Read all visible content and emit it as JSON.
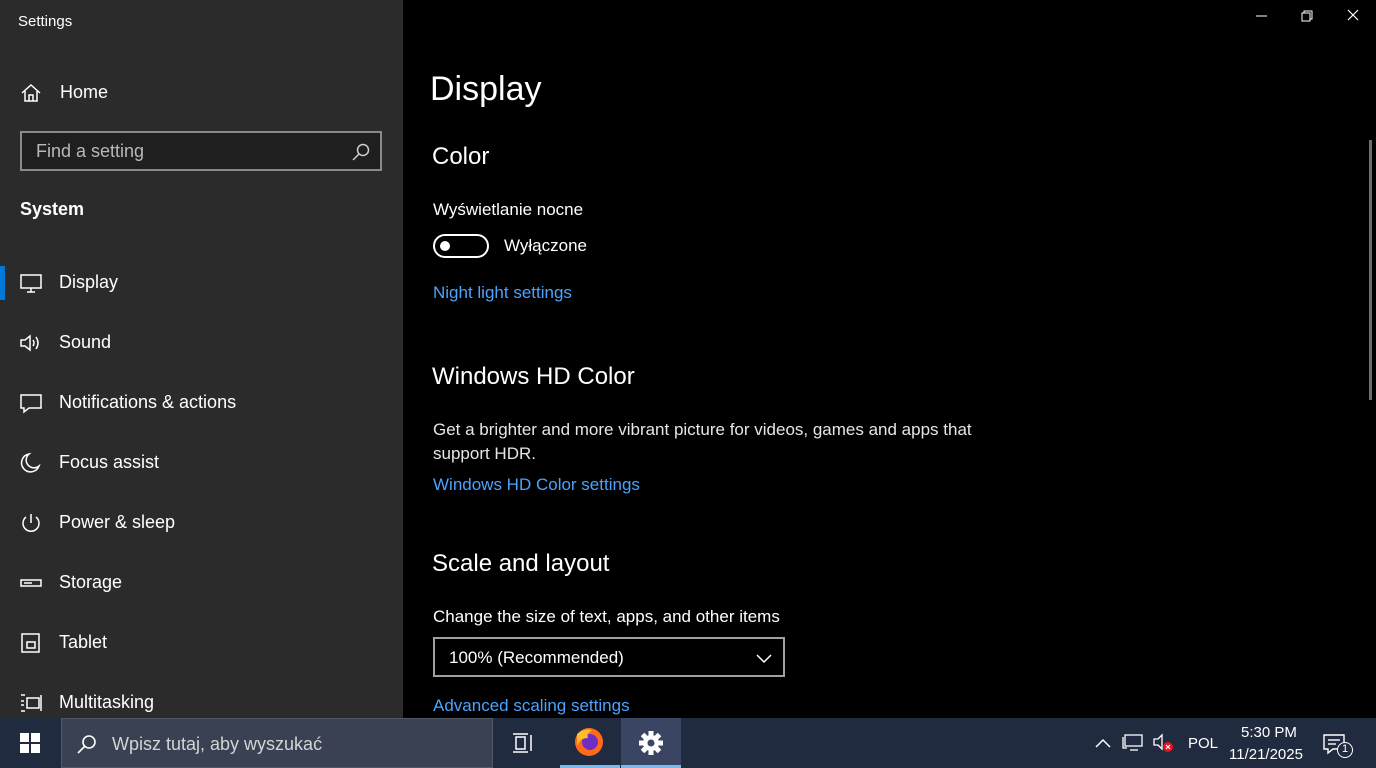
{
  "window": {
    "title": "Settings"
  },
  "sidebar": {
    "home_label": "Home",
    "search_placeholder": "Find a setting",
    "section": "System",
    "items": [
      {
        "label": "Display",
        "icon": "monitor-icon",
        "active": true
      },
      {
        "label": "Sound",
        "icon": "speaker-icon"
      },
      {
        "label": "Notifications & actions",
        "icon": "notification-icon"
      },
      {
        "label": "Focus assist",
        "icon": "moon-icon"
      },
      {
        "label": "Power & sleep",
        "icon": "power-icon"
      },
      {
        "label": "Storage",
        "icon": "storage-icon"
      },
      {
        "label": "Tablet",
        "icon": "tablet-icon"
      },
      {
        "label": "Multitasking",
        "icon": "multitasking-icon"
      }
    ]
  },
  "main": {
    "title": "Display",
    "color": {
      "heading": "Color",
      "night_label": "Wyświetlanie nocne",
      "toggle_state": "Wyłączone",
      "night_link": "Night light settings"
    },
    "hd": {
      "heading": "Windows HD Color",
      "description": "Get a brighter and more vibrant picture for videos, games and apps that support HDR.",
      "link": "Windows HD Color settings"
    },
    "scale": {
      "heading": "Scale and layout",
      "label": "Change the size of text, apps, and other items",
      "selected": "100% (Recommended)",
      "link": "Advanced scaling settings"
    }
  },
  "taskbar": {
    "search_placeholder": "Wpisz tutaj, aby wyszukać",
    "language": "POL",
    "time": "5:30 PM",
    "date": "11/21/2025",
    "notification_count": "1"
  },
  "colors": {
    "accent": "#0078d7",
    "link": "#4aa3ff",
    "sidebar_bg": "#2b2b2b",
    "taskbar_bg": "#202b3f"
  }
}
